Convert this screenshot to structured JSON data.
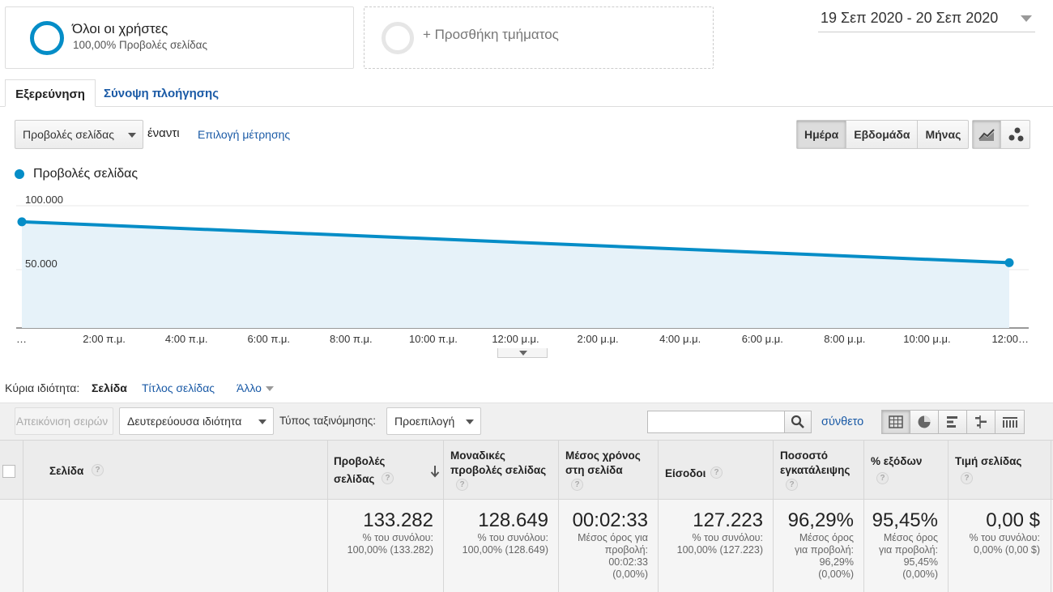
{
  "segments": {
    "all_users_title": "Όλοι οι χρήστες",
    "all_users_subtitle": "100,00% Προβολές σελίδας",
    "add_segment": "+ Προσθήκη τμήματος"
  },
  "date_range": "19 Σεπ 2020 - 20 Σεπ 2020",
  "tabs": {
    "explorer": "Εξερεύνηση",
    "navigation_summary": "Σύνοψη πλοήγησης"
  },
  "metric": {
    "selected": "Προβολές σελίδας",
    "versus": "έναντι",
    "select_metric": "Επιλογή μέτρησης"
  },
  "period_buttons": [
    "Ημέρα",
    "Εβδομάδα",
    "Μήνας"
  ],
  "icons": {
    "line_chart": "line-chart-icon",
    "motion_chart": "motion-chart-icon",
    "search": "search-icon",
    "view_table": "table-view-icon",
    "view_pie": "pie-view-icon",
    "view_performance": "performance-view-icon",
    "view_comparison": "comparison-view-icon",
    "view_pivot": "pivot-view-icon"
  },
  "colors": {
    "series": "#058dc7",
    "area_fill": "#e6f2f9",
    "link": "#1a5aa6"
  },
  "chart_data": {
    "type": "area",
    "legend": "Προβολές σελίδας",
    "y_ticks": [
      "100.000",
      "50.000"
    ],
    "ylim": [
      0,
      100000
    ],
    "x_tick_labels": [
      "…",
      "2:00 π.μ.",
      "4:00 π.μ.",
      "6:00 π.μ.",
      "8:00 π.μ.",
      "10:00 π.μ.",
      "12:00 μ.μ.",
      "2:00 μ.μ.",
      "4:00 μ.μ.",
      "6:00 μ.μ.",
      "8:00 μ.μ.",
      "10:00 μ.μ.",
      "12:00…"
    ],
    "points": [
      {
        "x": "19 Σεπ 2020",
        "y": 83000
      },
      {
        "x": "20 Σεπ 2020",
        "y": 51000
      }
    ],
    "grid": true
  },
  "primary_dimension": {
    "label": "Κύρια ιδιότητα:",
    "selected": "Σελίδα",
    "option_title": "Τίτλος σελίδας",
    "other": "Άλλο"
  },
  "toolbar": {
    "plot_rows": "Απεικόνιση σειρών",
    "secondary_dimension": "Δευτερεύουσα ιδιότητα",
    "sort_type_label": "Τύπος ταξινόμησης:",
    "sort_type_value": "Προεπιλογή",
    "search_placeholder": "",
    "advanced": "σύνθετο"
  },
  "table": {
    "columns": [
      {
        "key": "page",
        "label": "Σελίδα"
      },
      {
        "key": "pageviews",
        "label1": "Προβολές",
        "label2": "σελίδας"
      },
      {
        "key": "unique",
        "label1": "Μοναδικές",
        "label2": "προβολές σελίδας"
      },
      {
        "key": "avg_time",
        "label1": "Μέσος χρόνος",
        "label2": "στη σελίδα"
      },
      {
        "key": "entrances",
        "label": "Είσοδοι"
      },
      {
        "key": "bounce",
        "label1": "Ποσοστό",
        "label2": "εγκατάλειψης"
      },
      {
        "key": "exit",
        "label": "% εξόδων"
      },
      {
        "key": "value",
        "label": "Τιμή σελίδας"
      }
    ],
    "totals": {
      "pageviews": {
        "value": "133.282",
        "sub1": "% του συνόλου:",
        "sub2": "100,00% (133.282)"
      },
      "unique": {
        "value": "128.649",
        "sub1": "% του συνόλου:",
        "sub2": "100,00% (128.649)"
      },
      "avg_time": {
        "value": "00:02:33",
        "sub1": "Μέσος όρος για",
        "sub2": "προβολή:",
        "sub3": "00:02:33",
        "sub4": "(0,00%)"
      },
      "entrances": {
        "value": "127.223",
        "sub1": "% του συνόλου:",
        "sub2": "100,00% (127.223)"
      },
      "bounce": {
        "value": "96,29%",
        "sub1": "Μέσος όρος",
        "sub2": "για προβολή:",
        "sub3": "96,29%",
        "sub4": "(0,00%)"
      },
      "exit": {
        "value": "95,45%",
        "sub1": "Μέσος όρος",
        "sub2": "για προβολή:",
        "sub3": "95,45%",
        "sub4": "(0,00%)"
      },
      "value": {
        "value": "0,00 $",
        "sub1": "% του συνόλου:",
        "sub2": "0,00% (0,00 $)"
      }
    }
  }
}
